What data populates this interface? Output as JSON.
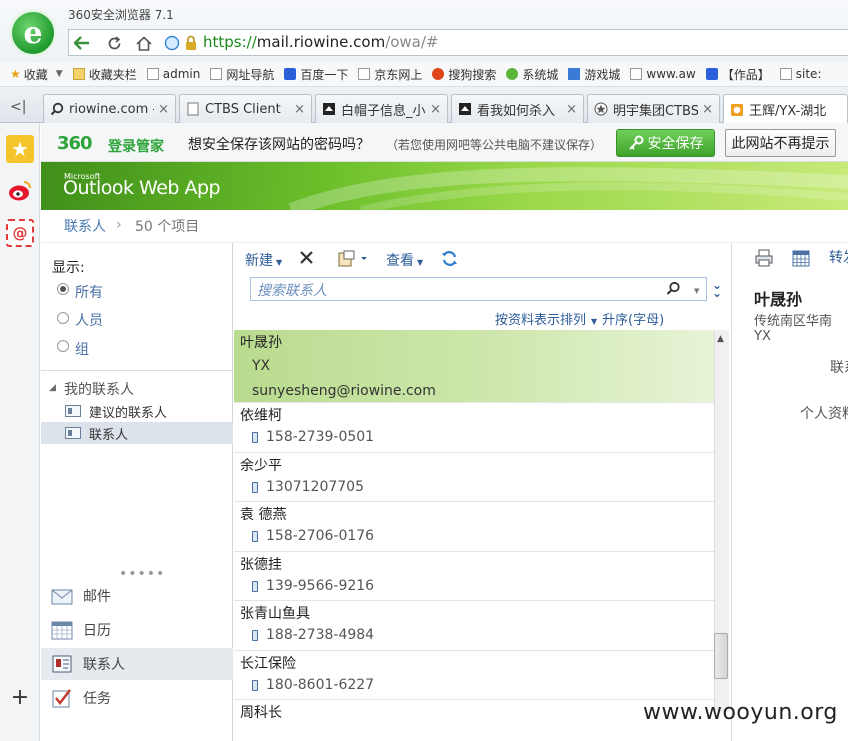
{
  "browser": {
    "title": "360安全浏览器 7.1",
    "url_scheme": "https://",
    "url_domain": "mail.riowine.com",
    "url_path": "/owa/#"
  },
  "bookmarks": [
    "收藏",
    "收藏夹栏",
    "admin",
    "网址导航",
    "百度一下",
    "京东网上",
    "搜狗搜索",
    "系统城",
    "游戏城",
    "www.aw",
    "【作品】",
    "site:"
  ],
  "tabs": [
    {
      "label": "riowine.com -"
    },
    {
      "label": "CTBS Client"
    },
    {
      "label": "白帽子信息_小"
    },
    {
      "label": "看我如何杀入"
    },
    {
      "label": "明宇集团CTBS"
    },
    {
      "label": "王辉/YX-湖北"
    }
  ],
  "notif": {
    "brand": "360",
    "manager": "登录管家",
    "question": "想安全保存该网站的密码吗？",
    "hint": "（若您使用网吧等公共电脑不建议保存）",
    "save_label": "安全保存",
    "dismiss_label": "此网站不再提示"
  },
  "owa": {
    "ms": "Microsoft",
    "title": "Outlook Web App"
  },
  "breadcrumb": {
    "section": "联系人",
    "count": "50 个项目"
  },
  "nav": {
    "show_label": "显示:",
    "filters": [
      "所有",
      "人员",
      "组"
    ],
    "folder_group": "我的联系人",
    "folders": [
      "建议的联系人",
      "联系人"
    ],
    "modules": [
      "邮件",
      "日历",
      "联系人",
      "任务"
    ]
  },
  "toolbar": {
    "new_label": "新建",
    "view_label": "查看",
    "search_placeholder": "搜索联系人",
    "sort_label": "按资料表示排列",
    "order_label": "升序(字母)"
  },
  "contacts": [
    {
      "name": "叶晟孙",
      "line1": "YX",
      "line2": "sunyesheng@riowine.com",
      "selected": true
    },
    {
      "name": "依维柯",
      "phone": "158-2739-0501"
    },
    {
      "name": "余少平",
      "phone": "13071207705"
    },
    {
      "name": "袁 德燕",
      "phone": "158-2706-0176"
    },
    {
      "name": "张德挂",
      "phone": "139-9566-9216"
    },
    {
      "name": "张青山鱼具",
      "phone": "188-2738-4984"
    },
    {
      "name": "长江保险",
      "phone": "180-8601-6227"
    },
    {
      "name": "周科长"
    }
  ],
  "reading": {
    "name": "叶晟孙",
    "dept": "传统南区华南",
    "company": "YX",
    "more1": "联系",
    "more2": "个人资料",
    "action": "转发"
  },
  "watermark": "www.wooyun.org",
  "colors": {
    "accent_green": "#3fa32b",
    "link_blue": "#2e5d9a",
    "selected_row": "#c6e29f"
  }
}
